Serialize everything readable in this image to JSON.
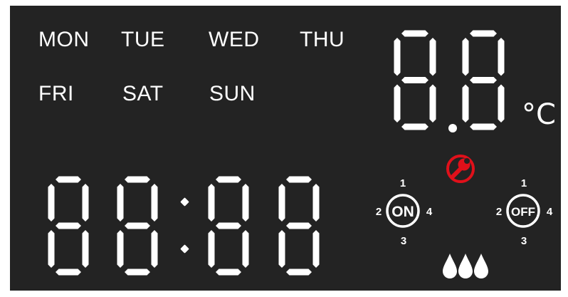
{
  "display": {
    "days": [
      "MON",
      "TUE",
      "WED",
      "THU",
      "FRI",
      "SAT",
      "SUN"
    ],
    "time_digits": [
      "8",
      "8",
      "8",
      "8"
    ],
    "temperature_digits": [
      "8",
      "8"
    ],
    "temperature_unit": "°C",
    "switch_on": {
      "label": "ON",
      "positions": [
        "1",
        "2",
        "3",
        "4"
      ]
    },
    "switch_off": {
      "label": "OFF",
      "positions": [
        "1",
        "2",
        "3",
        "4"
      ]
    },
    "icons": [
      "wrench-icon",
      "water-drops-icon"
    ],
    "colors": {
      "lcd_background": "#232323",
      "segment": "#ffffff",
      "alert": "#e0101a"
    }
  }
}
